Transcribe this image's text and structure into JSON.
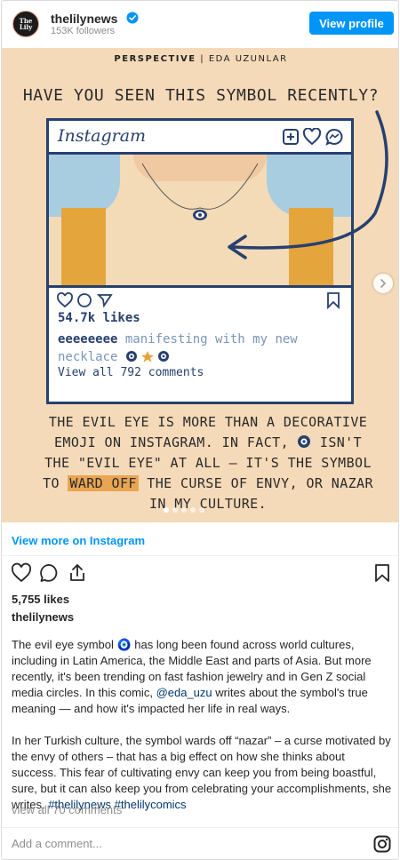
{
  "header": {
    "avatar_line1": "The",
    "avatar_line2": "Lily",
    "username": "thelilynews",
    "followers": "153K followers",
    "view_profile_label": "View profile"
  },
  "post_image": {
    "series_label": "PERSPECTIVE",
    "author_label": "| EDA UZUNLAR",
    "question": "HAVE YOU SEEN THIS SYMBOL RECENTLY?",
    "frame": {
      "app_name": "Instagram",
      "likes": "54.7k likes",
      "caption_user": "eeeeeeee",
      "caption_text": "manifesting with my new necklace",
      "comments_link": "View all 792 comments"
    },
    "body_part1": "THE EVIL EYE IS MORE THAN A DECORATIVE EMOJI ON INSTAGRAM. IN FACT,",
    "body_part2": "ISN'T THE \"EVIL EYE\" AT ALL – IT'S THE SYMBOL TO",
    "body_highlight": "WARD OFF",
    "body_part3": "THE CURSE OF ENVY, OR NAZAR IN MY CULTURE.",
    "carousel_dots": 5,
    "carousel_active": 1
  },
  "view_more": "View more on Instagram",
  "likes": "5,755 likes",
  "caption_username": "thelilynews",
  "caption": {
    "p1_before": "The evil eye symbol 🧿 has long been found across world cultures, including in Latin America, the Middle East and parts of Asia. But more recently, it's been trending on fast fashion jewelry and in Gen Z social media circles. In this comic,",
    "mention": "@eda_uzu",
    "p1_after": "writes about the symbol's true meaning — and how it's impacted her life in real ways.",
    "p2": "In her Turkish culture, the symbol wards off “nazar” – a curse motivated by the envy of others – that has a big effect on how she thinks about success. This fear of cultivating envy can keep you from being boastful, sure, but it can also keep you from celebrating your accomplishments, she writes.",
    "hashtag1": "#thelilynews",
    "hashtag2": "#thelilycomics"
  },
  "view_comments": "view all 70 comments",
  "comment_placeholder": "Add a comment...",
  "colors": {
    "accent": "#0095f6",
    "comic_background": "#f5dab9",
    "comic_navy": "#27406e",
    "highlight": "#e9a552"
  }
}
